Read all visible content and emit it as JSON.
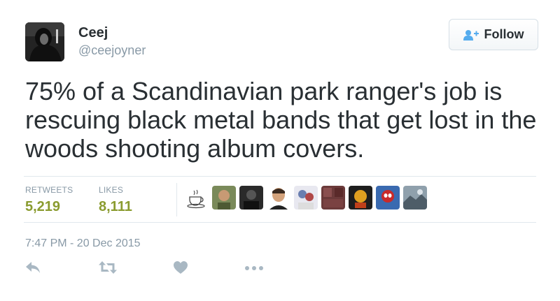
{
  "user": {
    "name": "Ceej",
    "handle": "@ceejoyner"
  },
  "follow_button": {
    "label": "Follow"
  },
  "tweet": {
    "text": "75% of a Scandinavian park ranger's job is rescuing black metal bands that get lost in the woods shooting album covers."
  },
  "stats": {
    "retweets_label": "RETWEETS",
    "retweets_value": "5,219",
    "likes_label": "LIKES",
    "likes_value": "8,111"
  },
  "timestamp": "7:47 PM - 20 Dec 2015",
  "colors": {
    "stat_value": "#8a9b2f",
    "muted_text": "#8899a6",
    "icon": "#a9b8c3",
    "follow_icon": "#55acee"
  },
  "icons": {
    "follow": "add-user-icon",
    "reply": "reply-icon",
    "retweet": "retweet-icon",
    "like": "heart-icon",
    "more": "more-dots-icon"
  }
}
